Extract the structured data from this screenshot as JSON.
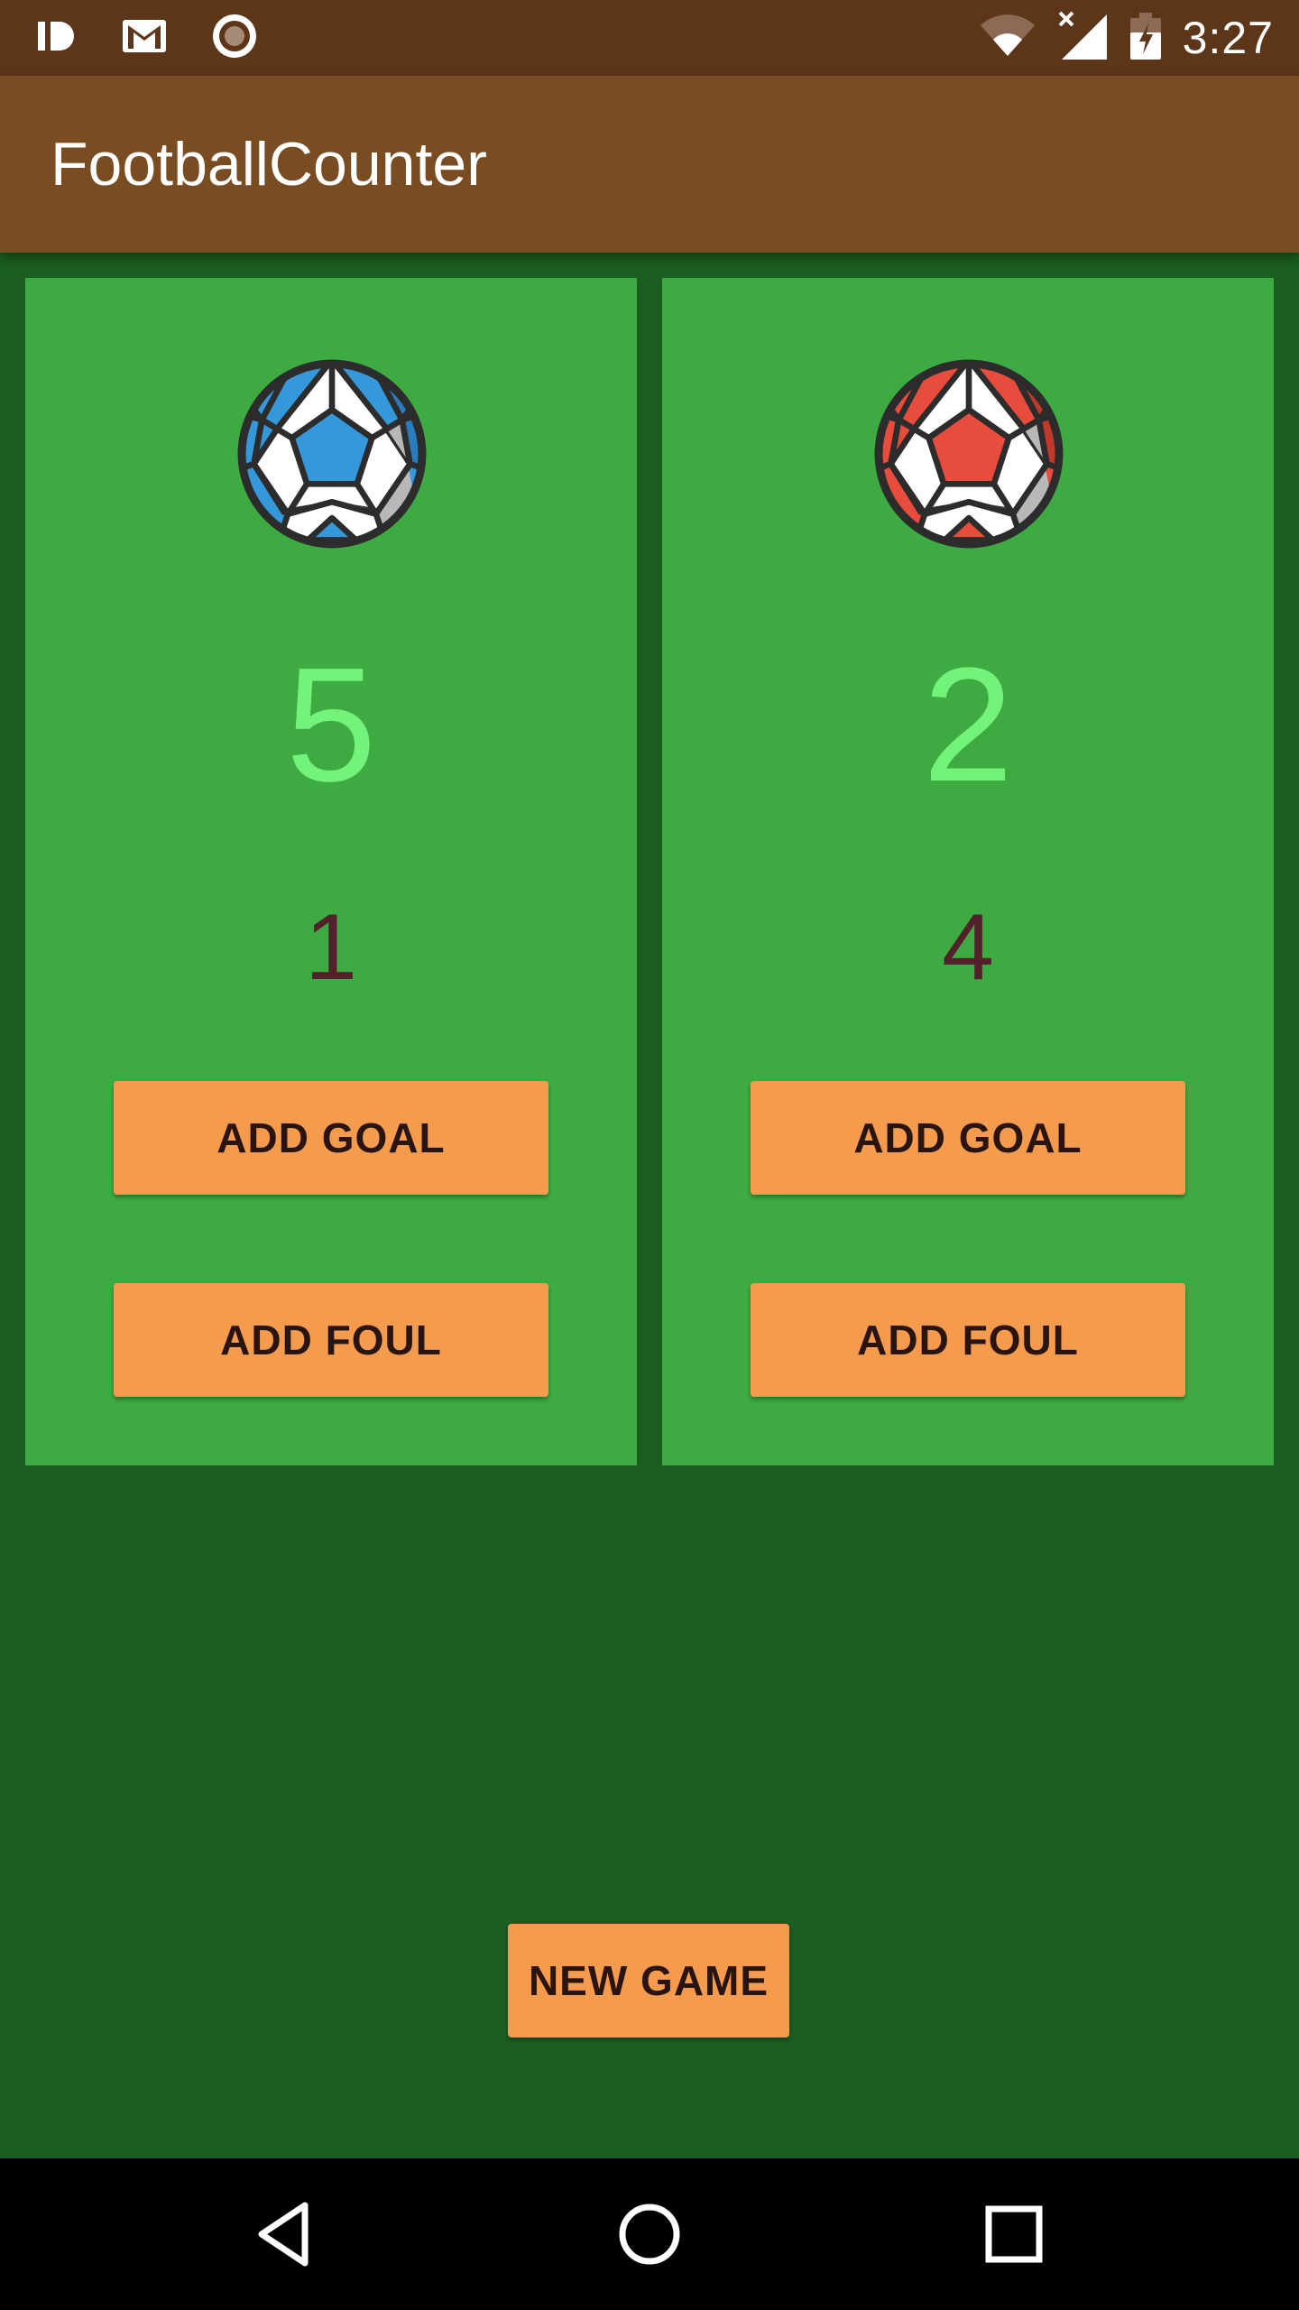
{
  "status_bar": {
    "time": "3:27",
    "left_icons": [
      "pushbullet-icon",
      "gmail-icon",
      "record-icon"
    ],
    "right_icons": [
      "wifi-icon",
      "signal-icon",
      "battery-charging-icon"
    ]
  },
  "app": {
    "title": "FootballCounter"
  },
  "teams": [
    {
      "ball_icon": "soccer-ball-blue-icon",
      "ball_color": "#3498db",
      "goals": "5",
      "fouls": "1",
      "add_goal_label": "ADD GOAL",
      "add_foul_label": "ADD FOUL"
    },
    {
      "ball_icon": "soccer-ball-red-icon",
      "ball_color": "#e74c3c",
      "goals": "2",
      "fouls": "4",
      "add_goal_label": "ADD GOAL",
      "add_foul_label": "ADD FOUL"
    }
  ],
  "new_game_label": "NEW GAME",
  "colors": {
    "status_bar": "#5d3519",
    "app_bar": "#7a4c22",
    "background": "#1b5e20",
    "panel": "#3eab42",
    "goals_text": "#74f37a",
    "fouls_text": "#53212c",
    "button": "#f59b4e"
  },
  "nav_bar": {
    "buttons": [
      "back-icon",
      "home-icon",
      "recents-icon"
    ]
  }
}
